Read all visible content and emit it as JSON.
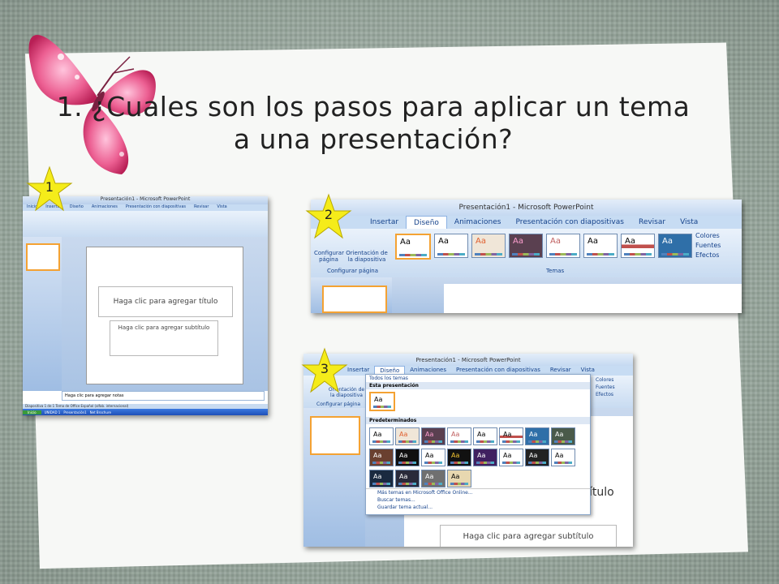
{
  "title": "1. ¿Cuales son los pasos para aplicar un tema a una presentación?",
  "steps": [
    "1",
    "2",
    "3"
  ],
  "shot1": {
    "window_title": "Presentación1 - Microsoft PowerPoint",
    "tabs": [
      "Inicio",
      "Insertar",
      "Diseño",
      "Animaciones",
      "Presentación con diapositivas",
      "Revisar",
      "Vista"
    ],
    "slide_title_placeholder": "Haga clic para agregar título",
    "slide_subtitle_placeholder": "Haga clic para agregar subtítulo",
    "notes_placeholder": "Haga clic para agregar notas",
    "status": "Diapositiva 1 de 1   Tema de Office   Español (alfab. internacional)",
    "taskbar": [
      "Inicio",
      "UNIDAD 1",
      "Presentación1",
      "Net Brochure"
    ]
  },
  "shot2": {
    "window_title": "Presentación1 - Microsoft PowerPoint",
    "tabs": [
      "Insertar",
      "Diseño",
      "Animaciones",
      "Presentación con diapositivas",
      "Revisar",
      "Vista"
    ],
    "setup_buttons": [
      "Configurar página",
      "Orientación de la diapositiva"
    ],
    "group_setup": "Configurar página",
    "group_themes": "Temas",
    "theme_label": "Aa",
    "theme_options": [
      "Colores",
      "Fuentes",
      "Efectos"
    ]
  },
  "shot3": {
    "window_title": "Presentación1 - Microsoft PowerPoint",
    "tabs": [
      "Insertar",
      "Diseño",
      "Animaciones",
      "Presentación con diapositivas",
      "Revisar",
      "Vista"
    ],
    "setup_label": "Orientación de la diapositiva",
    "group_setup": "Configurar página",
    "dropdown_header": "Todos los temas",
    "section_current": "Esta presentación",
    "section_builtin": "Predeterminados",
    "menu_items": [
      "Más temas en Microsoft Office Online...",
      "Buscar temas...",
      "Guardar tema actual..."
    ],
    "theme_options": [
      "Colores",
      "Fuentes",
      "Efectos"
    ],
    "subtitle_placeholder": "Haga clic para agregar subtítulo",
    "partial_text": "ítulo"
  },
  "colors": {
    "star": "#f5ec1a",
    "butterfly": "#e8407a",
    "ribbon_accent": "#15428b"
  }
}
